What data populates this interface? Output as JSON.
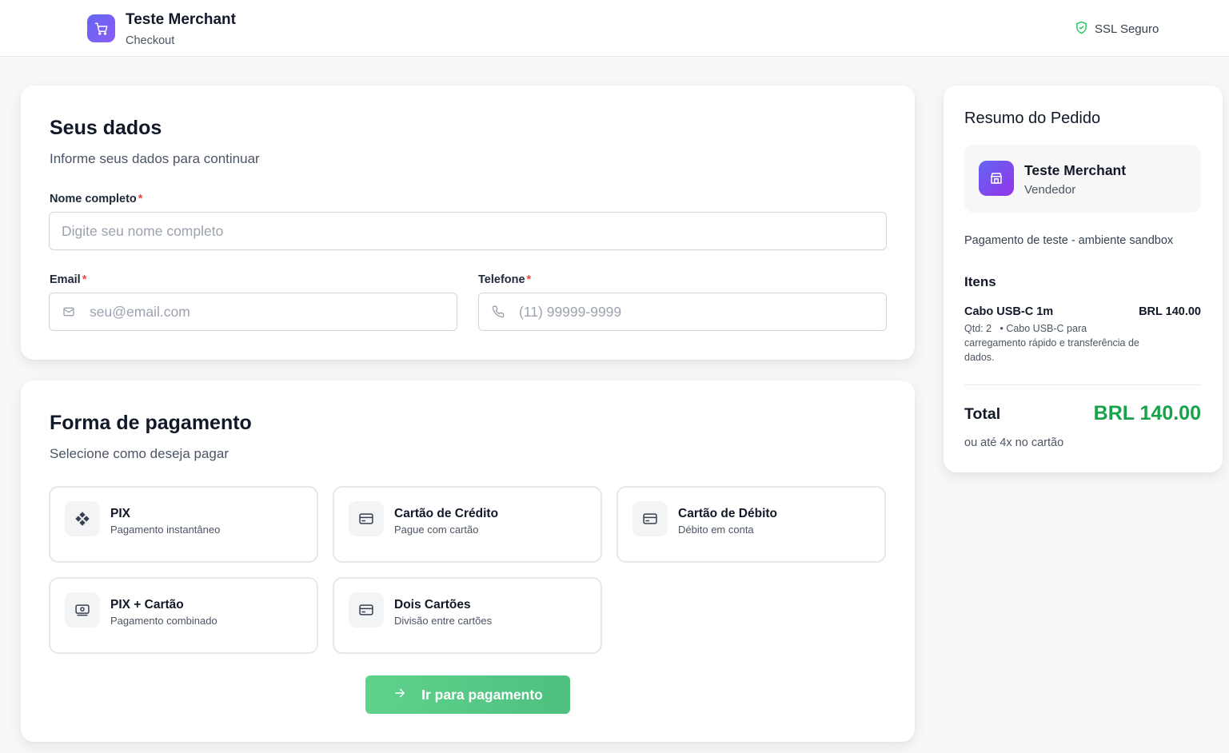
{
  "header": {
    "merchant_name": "Teste Merchant",
    "subtitle": "Checkout",
    "ssl_label": "SSL Seguro"
  },
  "personal": {
    "title": "Seus dados",
    "subtitle": "Informe seus dados para continuar",
    "name_label": "Nome completo",
    "name_placeholder": "Digite seu nome completo",
    "email_label": "Email",
    "email_placeholder": "seu@email.com",
    "phone_label": "Telefone",
    "phone_placeholder": "(11) 99999-9999",
    "required_mark": "*"
  },
  "payment": {
    "title": "Forma de pagamento",
    "subtitle": "Selecione como deseja pagar",
    "options": [
      {
        "title": "PIX",
        "subtitle": "Pagamento instantâneo",
        "icon": "pix-icon"
      },
      {
        "title": "Cartão de Crédito",
        "subtitle": "Pague com cartão",
        "icon": "credit-card-icon"
      },
      {
        "title": "Cartão de Débito",
        "subtitle": "Débito em conta",
        "icon": "debit-card-icon"
      },
      {
        "title": "PIX + Cartão",
        "subtitle": "Pagamento combinado",
        "icon": "cash-card-icon"
      },
      {
        "title": "Dois Cartões",
        "subtitle": "Divisão entre cartões",
        "icon": "two-cards-icon"
      }
    ],
    "submit_label": "Ir para pagamento"
  },
  "summary": {
    "title": "Resumo do Pedido",
    "merchant_name": "Teste Merchant",
    "merchant_role": "Vendedor",
    "description": "Pagamento de teste - ambiente sandbox",
    "items_heading": "Itens",
    "items": [
      {
        "name": "Cabo USB-C 1m",
        "price": "BRL 140.00",
        "qty": "Qtd: 2",
        "detail": "• Cabo USB-C para carregamento rápido e transferência de dados."
      }
    ],
    "total_label": "Total",
    "total_value": "BRL 140.00",
    "installments": "ou até 4x no cartão"
  },
  "colors": {
    "brand_gradient_start": "#6366f1",
    "brand_gradient_end": "#8b5cf6",
    "success": "#16a34a",
    "button": "#55c985",
    "required": "#ef4444"
  }
}
